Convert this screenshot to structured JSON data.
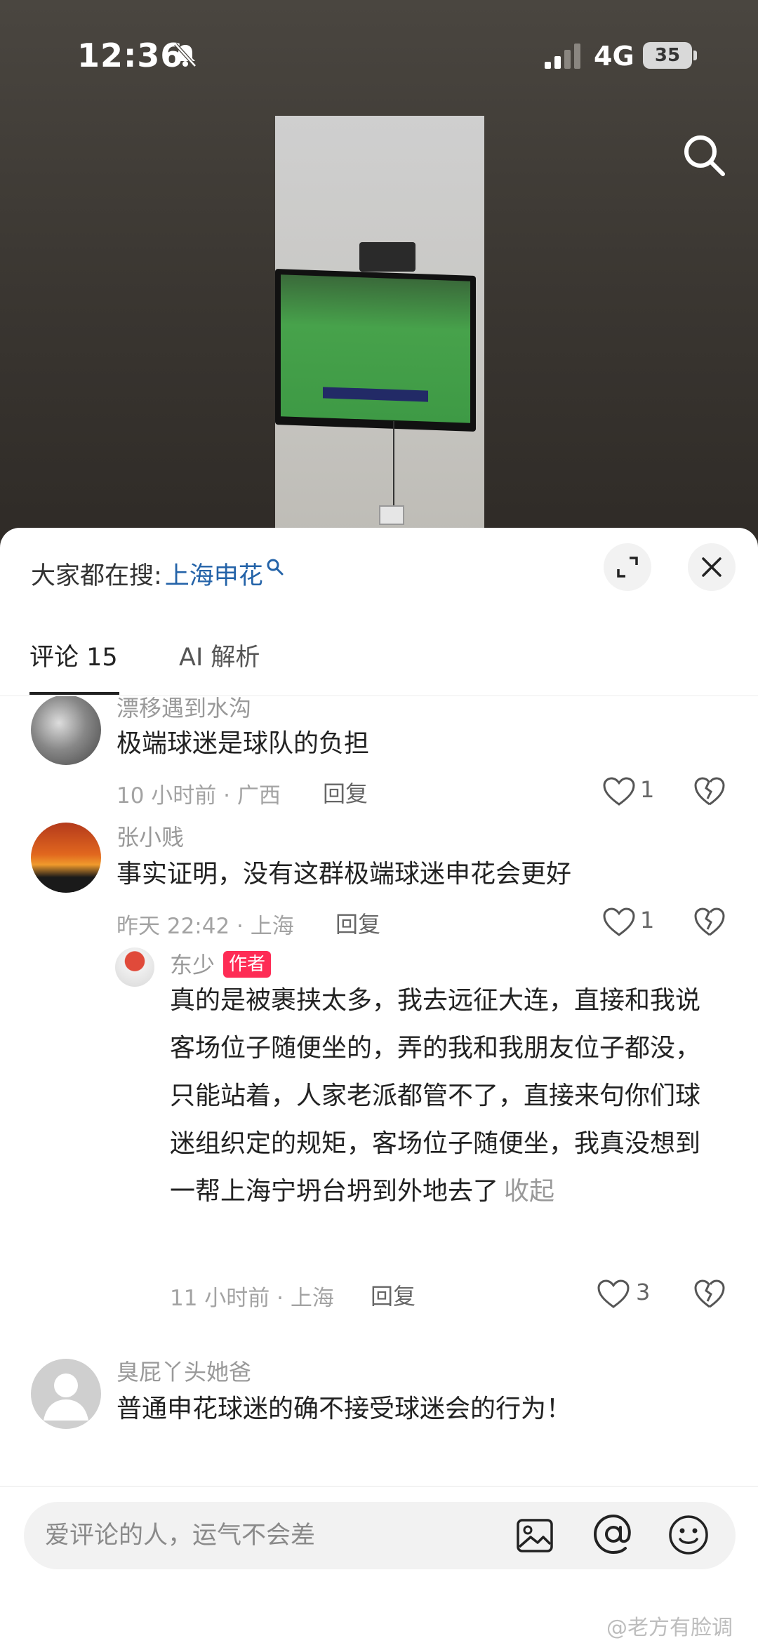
{
  "status_bar": {
    "time": "12:36",
    "network": "4G",
    "battery": "35"
  },
  "header": {
    "trending_prefix": "大家都在搜:",
    "trending_term": "上海申花"
  },
  "tabs": [
    {
      "label": "评论 15",
      "active": true
    },
    {
      "label": "AI 解析",
      "active": false
    }
  ],
  "comments": [
    {
      "username": "漂移遇到水沟",
      "text": "极端球迷是球队的负担",
      "meta": "10 小时前 · 广西",
      "reply_label": "回复",
      "likes": "1"
    },
    {
      "username": "张小贱",
      "text": "事实证明，没有这群极端球迷申花会更好",
      "meta": "昨天 22:42 · 上海",
      "reply_label": "回复",
      "likes": "1"
    },
    {
      "username": "东少",
      "badge": "作者",
      "text": "真的是被裹挟太多，我去远征大连，直接和我说客场位子随便坐的，弄的我和我朋友位子都没，只能站着，人家老派都管不了，直接来句你们球迷组织定的规矩，客场位子随便坐，我真没想到一帮上海宁坍台坍到外地去了",
      "collapse_label": "收起",
      "meta": "11 小时前 · 上海",
      "reply_label": "回复",
      "likes": "3"
    },
    {
      "username": "臭屁丫头她爸",
      "text": "普通申花球迷的确不接受球迷会的行为！"
    }
  ],
  "input": {
    "placeholder": "爱评论的人，运气不会差"
  },
  "watermark": "@老方有脸调",
  "colors": {
    "link": "#2463a8",
    "badge": "#fe2c55",
    "meta_text": "#a3a3a3"
  },
  "icons": [
    "mute-bell-icon",
    "signal-icon",
    "search-icon",
    "expand-icon",
    "close-icon",
    "heart-icon",
    "broken-heart-icon",
    "image-icon",
    "at-icon",
    "emoji-icon"
  ]
}
